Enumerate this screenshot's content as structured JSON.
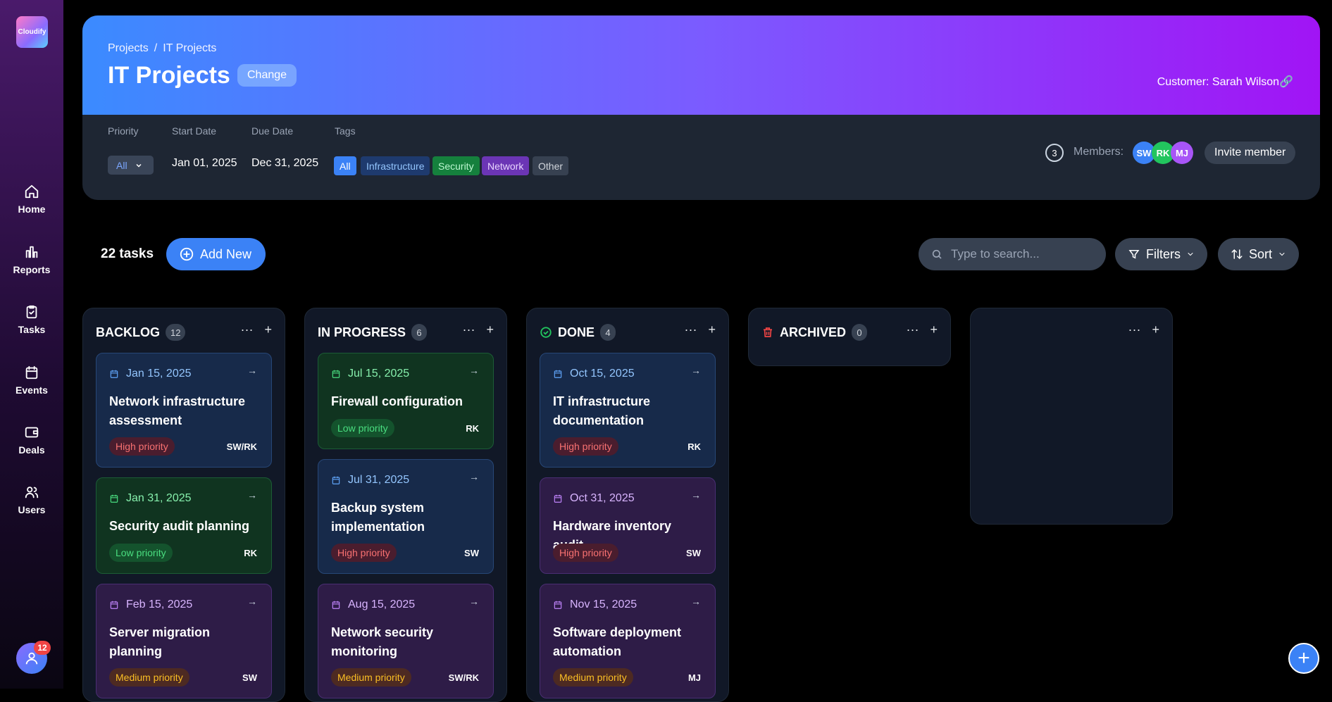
{
  "sidebar": {
    "logo_text": "Cloudify",
    "items": [
      {
        "label": "Home",
        "icon": "home-icon"
      },
      {
        "label": "Reports",
        "icon": "bar-chart-icon"
      },
      {
        "label": "Tasks",
        "icon": "clipboard-check-icon"
      },
      {
        "label": "Events",
        "icon": "calendar-icon"
      },
      {
        "label": "Deals",
        "icon": "wallet-icon"
      },
      {
        "label": "Users",
        "icon": "users-icon"
      }
    ],
    "notifications": "12"
  },
  "header": {
    "breadcrumb": [
      "Projects",
      "/",
      "IT Projects"
    ],
    "title": "IT Projects",
    "change_label": "Change",
    "customer": "Customer: Sarah Wilson🔗",
    "priority_label": "Priority",
    "priority_value": "All",
    "start_label": "Start Date",
    "start_value": "Jan 01, 2025",
    "due_label": "Due Date",
    "due_value": "Dec 31, 2025",
    "tags_label": "Tags",
    "tags": [
      "All",
      "Infrastructure",
      "Security",
      "Network",
      "Other"
    ],
    "members_count": "3",
    "members_label": "Members:",
    "members": [
      "SW",
      "RK",
      "MJ"
    ],
    "invite_label": "Invite member"
  },
  "toolbar": {
    "task_count": "22 tasks",
    "add_label": "Add New",
    "search_placeholder": "Type to search...",
    "filters_label": "Filters",
    "sort_label": "Sort"
  },
  "columns": [
    {
      "title": "BACKLOG",
      "count": "12",
      "cards": [
        {
          "date": "Jan 15, 2025",
          "title": "Network infrastructure assessment",
          "priority": "High priority",
          "assignee": "SW/RK"
        },
        {
          "date": "Jan 31, 2025",
          "title": "Security audit planning",
          "priority": "Low priority",
          "assignee": "RK"
        },
        {
          "date": "Feb 15, 2025",
          "title": "Server migration planning",
          "priority": "Medium priority",
          "assignee": "SW"
        }
      ]
    },
    {
      "title": "IN PROGRESS",
      "count": "6",
      "cards": [
        {
          "date": "Jul 15, 2025",
          "title": "Firewall configuration",
          "priority": "Low priority",
          "assignee": "RK"
        },
        {
          "date": "Jul 31, 2025",
          "title": "Backup system implementation",
          "priority": "High priority",
          "assignee": "SW"
        },
        {
          "date": "Aug 15, 2025",
          "title": "Network security monitoring",
          "priority": "Medium priority",
          "assignee": "SW/RK"
        }
      ]
    },
    {
      "title": "DONE",
      "count": "4",
      "cards": [
        {
          "date": "Oct 15, 2025",
          "title": "IT infrastructure documentation",
          "priority": "High priority",
          "assignee": "RK"
        },
        {
          "date": "Oct 31, 2025",
          "title": "Hardware inventory audit",
          "priority": "High priority",
          "assignee": "SW"
        },
        {
          "date": "Nov 15, 2025",
          "title": "Software deployment automation",
          "priority": "Medium priority",
          "assignee": "MJ"
        }
      ]
    },
    {
      "title": "ARCHIVED",
      "count": "0",
      "cards": []
    }
  ],
  "icons": {
    "more": "···",
    "add": "+",
    "arrow": "→",
    "fab": "+"
  }
}
